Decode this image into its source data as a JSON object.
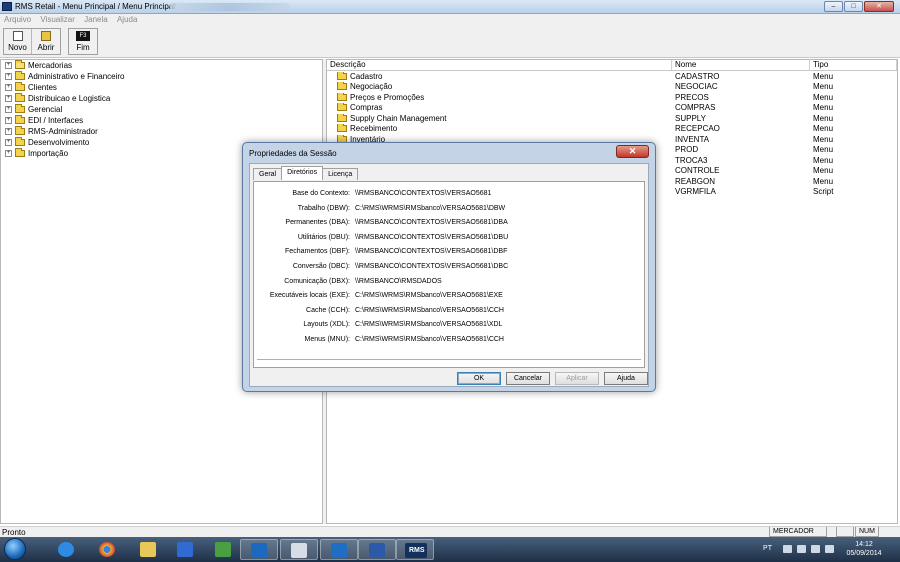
{
  "window": {
    "title": "RMS Retail - Menu Principal / Menu Principal",
    "minimize": "–",
    "maximize": "□",
    "close": "✕"
  },
  "menubar": [
    "Arquivo",
    "Visualizar",
    "Janela",
    "Ajuda"
  ],
  "toolbar": {
    "new_label": "Novo",
    "open_label": "Abrir",
    "end_label": "Fim",
    "end_key": "F3"
  },
  "tree": [
    {
      "label": "Mercadorias",
      "open": true
    },
    {
      "label": "Administrativo e Financeiro"
    },
    {
      "label": "Clientes"
    },
    {
      "label": "Distribuicao e Logistica"
    },
    {
      "label": "Gerencial"
    },
    {
      "label": "EDI / Interfaces"
    },
    {
      "label": "RMS-Administrador"
    },
    {
      "label": "Desenvolvimento"
    },
    {
      "label": "Importação"
    }
  ],
  "list": {
    "headers": [
      "Descrição",
      "Nome",
      "Tipo"
    ],
    "rows": [
      {
        "desc": "Cadastro",
        "name": "CADASTRO",
        "type": "Menu",
        "folder": true
      },
      {
        "desc": "Negociação",
        "name": "NEGOCIAC",
        "type": "Menu",
        "folder": true
      },
      {
        "desc": "Preços e Promoções",
        "name": "PRECOS",
        "type": "Menu",
        "folder": true
      },
      {
        "desc": "Compras",
        "name": "COMPRAS",
        "type": "Menu",
        "folder": true
      },
      {
        "desc": "Supply Chain Management",
        "name": "SUPPLY",
        "type": "Menu",
        "folder": true
      },
      {
        "desc": "Recebimento",
        "name": "RECEPCAO",
        "type": "Menu",
        "folder": true
      },
      {
        "desc": "Inventário",
        "name": "INVENTA",
        "type": "Menu",
        "folder": true
      },
      {
        "desc": "",
        "name": "PROD",
        "type": "Menu",
        "folder": false
      },
      {
        "desc": "",
        "name": "TROCA3",
        "type": "Menu",
        "folder": false
      },
      {
        "desc": "",
        "name": "CONTROLE",
        "type": "Menu",
        "folder": false
      },
      {
        "desc": "",
        "name": "REABGON",
        "type": "Menu",
        "folder": false
      },
      {
        "desc": "",
        "name": "VGRMFILA",
        "type": "Script",
        "folder": false
      }
    ]
  },
  "dialog": {
    "title": "Propriedades da Sessão",
    "close": "✕",
    "tabs": [
      "Geral",
      "Diretórios",
      "Licença"
    ],
    "active_tab": "Diretórios",
    "directories": [
      {
        "label": "Base do Contexto:",
        "value": "\\\\RMSBANCO\\CONTEXTOS\\VERSAO5681"
      },
      {
        "label": "Trabalho (DBW):",
        "value": "C:\\RMS\\WRMS\\RMSbanco\\VERSAO5681\\DBW"
      },
      {
        "label": "Permanentes (DBA):",
        "value": "\\\\RMSBANCO\\CONTEXTOS\\VERSAO5681\\DBA"
      },
      {
        "label": "Utilitários (DBU):",
        "value": "\\\\RMSBANCO\\CONTEXTOS\\VERSAO5681\\DBU"
      },
      {
        "label": "Fechamentos (DBF):",
        "value": "\\\\RMSBANCO\\CONTEXTOS\\VERSAO5681\\DBF"
      },
      {
        "label": "Conversão (DBC):",
        "value": "\\\\RMSBANCO\\CONTEXTOS\\VERSAO5681\\DBC"
      },
      {
        "label": "Comunicação (DBX):",
        "value": "\\\\RMSBANCO\\RMSDADOS"
      },
      {
        "label": "Executáveis locais (EXE):",
        "value": "C:\\RMS\\WRMS\\RMSbanco\\VERSAO5681\\EXE"
      },
      {
        "label": "Cache (CCH):",
        "value": "C:\\RMS\\WRMS\\RMSbanco\\VERSAO5681\\CCH"
      },
      {
        "label": "Layouts (XDL):",
        "value": "C:\\RMS\\WRMS\\RMSbanco\\VERSAO5681\\XDL"
      },
      {
        "label": "Menus (MNU):",
        "value": "C:\\RMS\\WRMS\\RMSbanco\\VERSAO5681\\CCH"
      }
    ],
    "buttons": {
      "ok": "OK",
      "cancel": "Cancelar",
      "apply": "Aplicar",
      "help": "Ajuda"
    }
  },
  "statusbar": {
    "status": "Pronto",
    "user": "MERCADOR",
    "num": "NUM"
  },
  "taskbar": {
    "apps": [
      "internet-explorer",
      "chrome",
      "file-explorer",
      "media-player",
      "app-green",
      "lync",
      "app-people",
      "outlook",
      "word",
      "rms"
    ],
    "rms_label": "RMS",
    "lang": "PT",
    "time": "14:12",
    "date": "05/09/2014"
  },
  "colors": {
    "dialog_frame": "#c4d3e6",
    "folder": "#f2d34b",
    "taskbar": "#1e3047"
  }
}
